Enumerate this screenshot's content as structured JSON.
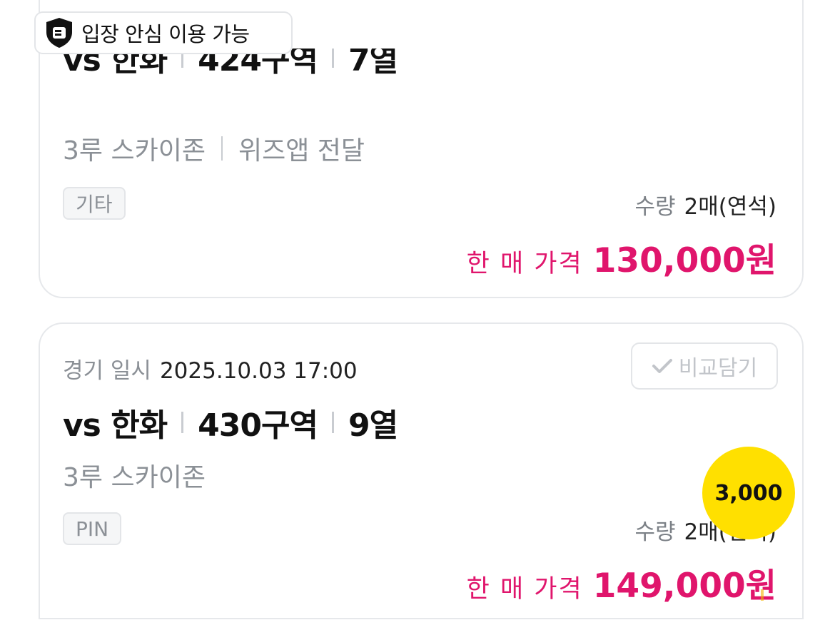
{
  "badge": {
    "label": "입장 안심 이용 가능",
    "icon": "shield-logo-icon"
  },
  "listings": [
    {
      "title": {
        "team": "vs 한화",
        "section": "424구역",
        "row": "7열"
      },
      "subtitle": {
        "zone": "3루 스카이존",
        "delivery": "위즈앱 전달"
      },
      "tag": "기타",
      "quantity": {
        "label": "수량",
        "value": "2매(연석)"
      },
      "price": {
        "label": "한 매 가격",
        "value": "130,000원"
      }
    },
    {
      "date": {
        "label": "경기 일시",
        "value": "2025.10.03 17:00"
      },
      "compare_button": "비교담기",
      "title": {
        "team": "vs 한화",
        "section": "430구역",
        "row": "9열"
      },
      "subtitle": {
        "zone": "3루 스카이존"
      },
      "tag": "PIN",
      "quantity": {
        "label": "수량",
        "value": "2매(연석)"
      },
      "price": {
        "label": "한 매 가격",
        "value": "149,000원"
      }
    }
  ],
  "coin_badge": "3,000",
  "colors": {
    "price": "#e0156c",
    "coin": "#ffe000",
    "muted": "#8b9096"
  }
}
